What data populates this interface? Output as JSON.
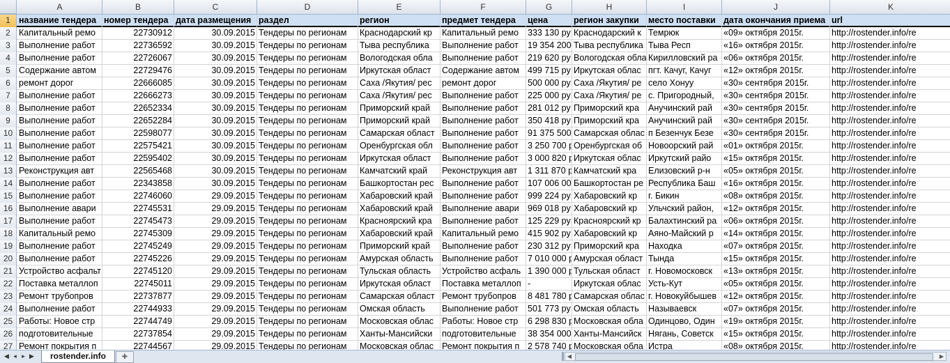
{
  "sheet": {
    "columns": [
      "A",
      "B",
      "C",
      "D",
      "E",
      "F",
      "G",
      "H",
      "I",
      "J",
      "K"
    ],
    "rows": [
      {
        "n": "1",
        "cells": [
          "название тендера",
          "номер тендера",
          "дата размещения",
          "раздел",
          "регион",
          "предмет тендера",
          "цена",
          "регион закупки",
          "место поставки",
          "дата окончания приема",
          "url"
        ]
      },
      {
        "n": "2",
        "cells": [
          "Капитальный ремо",
          "22730912",
          "30.09.2015",
          "Тендеры по регионам",
          "Краснодарский кр",
          "Капитальный ремо",
          "333 130 ру",
          "Краснодарский к",
          "Темрюк",
          "«09» октября 2015г.",
          "http://rostender.info/re"
        ]
      },
      {
        "n": "3",
        "cells": [
          "Выполнение работ",
          "22736592",
          "30.09.2015",
          "Тендеры по регионам",
          "Тыва республика",
          "Выполнение работ",
          "19 354 200",
          "Тыва республика",
          "Тыва Респ",
          "«16» октября 2015г.",
          "http://rostender.info/re"
        ]
      },
      {
        "n": "4",
        "cells": [
          "Выполнение работ",
          "22726067",
          "30.09.2015",
          "Тендеры по регионам",
          "Вологодская обла",
          "Выполнение работ",
          "219 620 ру",
          "Вологодская обла",
          "Кирилловский ра",
          "«06» октября 2015г.",
          "http://rostender.info/re"
        ]
      },
      {
        "n": "5",
        "cells": [
          "Содержание автом",
          "22729476",
          "30.09.2015",
          "Тендеры по регионам",
          "Иркутская област",
          "Содержание автом",
          "499 715 ру",
          "Иркутская облас",
          "пгт. Качуг, Качуг",
          "«12» октября 2015г.",
          "http://rostender.info/re"
        ]
      },
      {
        "n": "6",
        "cells": [
          "ремонт дорог",
          "22666085",
          "30.09.2015",
          "Тендеры по регионам",
          "Саха /Якутия/ рес",
          "ремонт дорог",
          "500 000 ру",
          "Саха /Якутия/ ре",
          "село Хонуу",
          "«30» сентября 2015г.",
          "http://rostender.info/re"
        ]
      },
      {
        "n": "7",
        "cells": [
          "Выполнение работ",
          "22666273",
          "30.09.2015",
          "Тендеры по регионам",
          "Саха /Якутия/ рес",
          "Выполнение работ",
          "225 000 ру",
          "Саха /Якутия/ ре",
          "с. Пригородный,",
          "«30» сентября 2015г.",
          "http://rostender.info/re"
        ]
      },
      {
        "n": "8",
        "cells": [
          "Выполнение работ",
          "22652334",
          "30.09.2015",
          "Тендеры по регионам",
          "Приморский край",
          "Выполнение работ",
          "281 012 ру",
          "Приморский кра",
          "Анучинский рай",
          "«30» сентября 2015г.",
          "http://rostender.info/re"
        ]
      },
      {
        "n": "9",
        "cells": [
          "Выполнение работ",
          "22652284",
          "30.09.2015",
          "Тендеры по регионам",
          "Приморский край",
          "Выполнение работ",
          "350 418 ру",
          "Приморский кра",
          "Анучинский рай",
          "«30» сентября 2015г.",
          "http://rostender.info/re"
        ]
      },
      {
        "n": "10",
        "cells": [
          "Выполнение работ",
          "22598077",
          "30.09.2015",
          "Тендеры по регионам",
          "Самарская област",
          "Выполнение работ",
          "91 375 500",
          "Самарская облас",
          "п Безенчук Безе",
          "«30» сентября 2015г.",
          "http://rostender.info/re"
        ]
      },
      {
        "n": "11",
        "cells": [
          "Выполнение работ",
          "22575421",
          "30.09.2015",
          "Тендеры по регионам",
          "Оренбургская обл",
          "Выполнение работ",
          "3 250 700 р",
          "Оренбургская об",
          "Новоорский рай",
          "«01» октября 2015г.",
          "http://rostender.info/re"
        ]
      },
      {
        "n": "12",
        "cells": [
          "Выполнение работ",
          "22595402",
          "30.09.2015",
          "Тендеры по регионам",
          "Иркутская област",
          "Выполнение работ",
          "3 000 820 ру",
          "Иркутская облас",
          "Иркутский райо",
          "«15» октября 2015г.",
          "http://rostender.info/re"
        ]
      },
      {
        "n": "13",
        "cells": [
          "Реконструкция авт",
          "22565468",
          "30.09.2015",
          "Тендеры по регионам",
          "Камчатский край",
          "Реконструкция авт",
          "1 311 870 р",
          "Камчатский кра",
          "Елизовский р-н",
          "«05» октября 2015г.",
          "http://rostender.info/re"
        ]
      },
      {
        "n": "14",
        "cells": [
          "Выполнение работ",
          "22343858",
          "30.09.2015",
          "Тендеры по регионам",
          "Башкортостан рес",
          "Выполнение работ",
          "107 006 00",
          "Башкортостан ре",
          "Республика Баш",
          "«16» октября 2015г.",
          "http://rostender.info/re"
        ]
      },
      {
        "n": "15",
        "cells": [
          "Выполнение работ",
          "22746060",
          "29.09.2015",
          "Тендеры по регионам",
          "Хабаровский край",
          "Выполнение работ",
          "999 224 ру",
          "Хабаровский кр",
          "г. Бикин",
          "«08» октября 2015г.",
          "http://rostender.info/re"
        ]
      },
      {
        "n": "16",
        "cells": [
          "Выполнение авари",
          "22745531",
          "29.09.2015",
          "Тендеры по регионам",
          "Хабаровский край",
          "Выполнение авари",
          "969 018 ру",
          "Хабаровский кр",
          "Ульчский район,",
          "«12» октября 2015г.",
          "http://rostender.info/re"
        ]
      },
      {
        "n": "17",
        "cells": [
          "Выполнение работ",
          "22745473",
          "29.09.2015",
          "Тендеры по регионам",
          "Красноярский кра",
          "Выполнение работ",
          "125 229 ру",
          "Красноярский кр",
          "Балахтинский ра",
          "«06» октября 2015г.",
          "http://rostender.info/re"
        ]
      },
      {
        "n": "18",
        "cells": [
          "Капитальный ремо",
          "22745309",
          "29.09.2015",
          "Тендеры по регионам",
          "Хабаровский край",
          "Капитальный ремо",
          "415 902 ру",
          "Хабаровский кр",
          "Аяно-Майский р",
          "«14» октября 2015г.",
          "http://rostender.info/re"
        ]
      },
      {
        "n": "19",
        "cells": [
          "Выполнение работ",
          "22745249",
          "29.09.2015",
          "Тендеры по регионам",
          "Приморский край",
          "Выполнение работ",
          "230 312 ру",
          "Приморский кра",
          "Находка",
          "«07» октября 2015г.",
          "http://rostender.info/re"
        ]
      },
      {
        "n": "20",
        "cells": [
          "Выполнение работ",
          "22745226",
          "29.09.2015",
          "Тендеры по регионам",
          "Амурская область",
          "Выполнение работ",
          "7 010 000 р",
          "Амурская област",
          "Тында",
          "«15» октября 2015г.",
          "http://rostender.info/re"
        ]
      },
      {
        "n": "21",
        "cells": [
          "Устройство асфальт",
          "22745120",
          "29.09.2015",
          "Тендеры по регионам",
          "Тульская область",
          "Устройство асфаль",
          "1 390 000 р",
          "Тульская област",
          "г. Новомосковск",
          "«13» октября 2015г.",
          "http://rostender.info/re"
        ]
      },
      {
        "n": "22",
        "cells": [
          "Поставка металлоп",
          "22745011",
          "29.09.2015",
          "Тендеры по регионам",
          "Иркутская област",
          "Поставка металлоп",
          "-",
          "Иркутская облас",
          "Усть-Кут",
          "«05» октября 2015г.",
          "http://rostender.info/re"
        ]
      },
      {
        "n": "23",
        "cells": [
          "Ремонт трубопров",
          "22737877",
          "29.09.2015",
          "Тендеры по регионам",
          "Самарская област",
          "Ремонт трубопров",
          "8 481 780 р",
          "Самарская облас",
          "г. Новокуйбышев",
          "«12» октября 2015г.",
          "http://rostender.info/re"
        ]
      },
      {
        "n": "24",
        "cells": [
          "Выполнение работ",
          "22744933",
          "29.09.2015",
          "Тендеры по регионам",
          "Омская область",
          "Выполнение работ",
          "501 773 ру",
          "Омская область",
          "Называевск",
          "«07» октября 2015г.",
          "http://rostender.info/re"
        ]
      },
      {
        "n": "25",
        "cells": [
          "Работы: Новое стр",
          "22744749",
          "29.09.2015",
          "Тендеры по регионам",
          "Московская облас",
          "Работы: Новое стр",
          "6 298 830 р",
          "Московская обла",
          "Одинцово, Один",
          "«19» октября 2015г.",
          "http://rostender.info/re"
        ]
      },
      {
        "n": "26",
        "cells": [
          "подготовительные",
          "22737854",
          "29.09.2015",
          "Тендеры по регионам",
          "Ханты-Мансийски",
          "подготовительные",
          "38 354 000",
          "Ханты-Мансийск",
          "Нягань, Советск",
          "«15» октября 2015г.",
          "http://rostender.info/re"
        ]
      },
      {
        "n": "27",
        "cells": [
          "Ремонт покрытия п",
          "22744567",
          "29.09.2015",
          "Тендеры по регионам",
          "Московская облас",
          "Ремонт покрытия п",
          "2 578 740 р",
          "Московская обла",
          "Истра",
          "«08» октября 2015г.",
          "http://rostender.info/re"
        ]
      }
    ]
  },
  "tabs": {
    "active": "rostender.info"
  }
}
